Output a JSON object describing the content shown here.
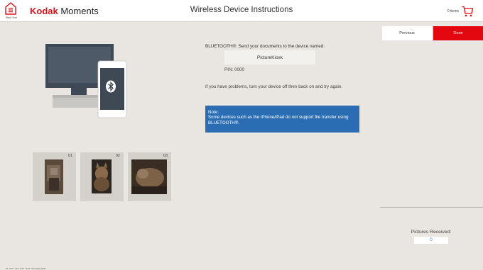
{
  "header": {
    "start_over_label": "Start Over",
    "brand_kodak": "Kodak",
    "brand_moments": " Moments",
    "title": "Wireless Device Instructions",
    "cart_count": "0 items",
    "cart_icon": "shopping-cart-icon",
    "home_icon": "home-icon",
    "accent_color": "#e3070f"
  },
  "nav": {
    "previous_label": "Previous",
    "done_label": "Done"
  },
  "instructions": {
    "line1": "BLUETOOTH®: Send your documents to the device named:",
    "device_name": "PictureKiosk",
    "pin": "PIN: 0000",
    "problems": "If you have problems, turn your device off then back on and try again.",
    "note": "Note:\nSome devices such as the iPhone/iPad do not support file transfer using BLUETOOTH®.",
    "note_color": "#2b6db3"
  },
  "illustration": {
    "icon": "bluetooth-icon"
  },
  "thumbnails": [
    {
      "number": "01"
    },
    {
      "number": "02"
    },
    {
      "number": "03"
    }
  ],
  "received": {
    "label": "Pictures Received:",
    "count": "0"
  },
  "build_info": "RT: XPK / V8.0.7760 - Build: 2019.0403.0300"
}
